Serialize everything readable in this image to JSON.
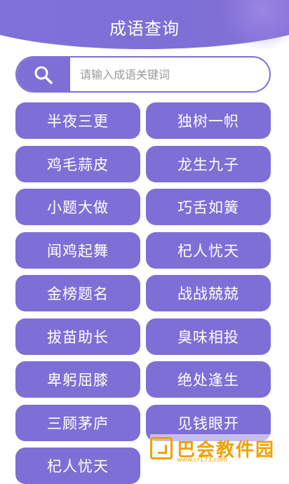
{
  "header": {
    "title": "成语查询"
  },
  "search": {
    "placeholder": "请输入成语关键词",
    "icon": "search-icon"
  },
  "idioms": [
    [
      "半夜三更",
      "独树一帜"
    ],
    [
      "鸡毛蒜皮",
      "龙生九子"
    ],
    [
      "小题大做",
      "巧舌如簧"
    ],
    [
      "闻鸡起舞",
      "杞人忧天"
    ],
    [
      "金榜题名",
      "战战兢兢"
    ],
    [
      "拔苗助长",
      "臭味相投"
    ],
    [
      "卑躬屈膝",
      "绝处逢生"
    ],
    [
      "三顾茅庐",
      "见钱眼开"
    ],
    [
      "杞人忧天",
      ""
    ]
  ],
  "watermark": {
    "text": "巴会教件园",
    "url": "www.cr173.com"
  },
  "colors": {
    "accent": "#7e6fd6",
    "watermark": "#f0a100"
  }
}
